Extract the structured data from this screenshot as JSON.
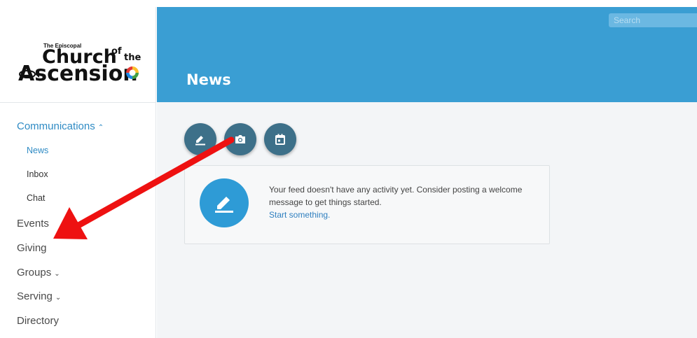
{
  "logo": {
    "line_small": "The Episcopal",
    "line_church": "Church",
    "line_of": "of",
    "line_the": "the",
    "line_ascension": "Ascension"
  },
  "sidebar": {
    "items": [
      {
        "label": "Communications",
        "chevron": "^",
        "active": true
      },
      {
        "label": "News",
        "active": true
      },
      {
        "label": "Inbox"
      },
      {
        "label": "Chat"
      },
      {
        "label": "Events"
      },
      {
        "label": "Giving"
      },
      {
        "label": "Groups",
        "chevron": "v"
      },
      {
        "label": "Serving",
        "chevron": "v"
      },
      {
        "label": "Directory"
      }
    ]
  },
  "header": {
    "title": "News",
    "search_placeholder": "Search"
  },
  "feed": {
    "actions": [
      {
        "icon": "pencil-icon"
      },
      {
        "icon": "camera-icon"
      },
      {
        "icon": "calendar-icon"
      }
    ],
    "empty_message": "Your feed doesn't have any activity yet. Consider posting a welcome message to get things started.",
    "cta_link": "Start something."
  },
  "colors": {
    "header_blue": "#3a9ed3",
    "fab_teal": "#3d7089",
    "card_icon_blue": "#2e9bd6",
    "annotation_arrow": "#ee1111",
    "link_blue": "#2f7fbf"
  }
}
